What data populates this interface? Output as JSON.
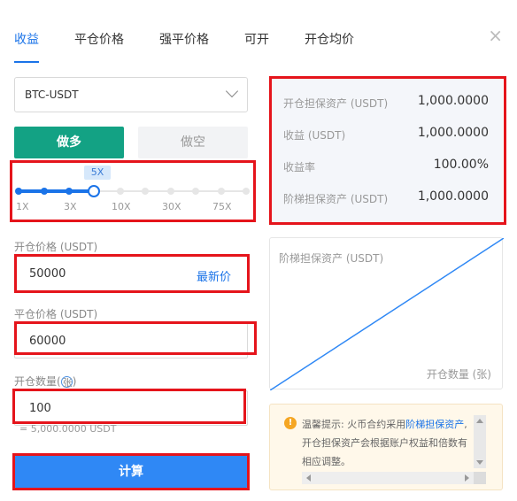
{
  "tabs": [
    {
      "label": "收益",
      "active": true
    },
    {
      "label": "平仓价格"
    },
    {
      "label": "强平价格"
    },
    {
      "label": "可开"
    },
    {
      "label": "开仓均价"
    }
  ],
  "close_glyph": "×",
  "pair_select": {
    "value": "BTC-USDT",
    "icon": "chevron-down-icon"
  },
  "direction": {
    "long_label": "做多",
    "short_label": "做空",
    "long_color": "#13a284"
  },
  "leverage": {
    "current_label": "5X",
    "ticks": [
      "1X",
      "3X",
      "10X",
      "30X",
      "75X"
    ]
  },
  "open_price": {
    "label": "开仓价格 (USDT)",
    "value": "50000",
    "latest_link": "最新价"
  },
  "close_price": {
    "label": "平仓价格 (USDT)",
    "value": "60000"
  },
  "open_qty": {
    "label_prefix": "开仓数量(",
    "label_highlight": "张",
    "label_suffix": ")",
    "value": "100",
    "hint": "= 5,000.0000 USDT"
  },
  "calc_button": {
    "label": "计算",
    "color": "#2f88f5"
  },
  "results": [
    {
      "key": "开仓担保资产 (USDT)",
      "value": "1,000.0000"
    },
    {
      "key": "收益 (USDT)",
      "value": "1,000.0000"
    },
    {
      "key": "收益率",
      "value": "100.00%"
    },
    {
      "key": "阶梯担保资产 (USDT)",
      "value": "1,000.0000"
    }
  ],
  "chart": {
    "ylabel": "阶梯担保资产 (USDT)",
    "xlabel": "开仓数量 (张)"
  },
  "notice": {
    "prefix": "温馨提示: 火币合约采用",
    "highlight": "阶梯担保资产",
    "suffix": ", 开仓担保资产会根据账户权益和倍数有相应调整。"
  },
  "colors": {
    "accent": "#1a73e8",
    "highlight_box": "#e5141b",
    "long": "#13a284"
  }
}
